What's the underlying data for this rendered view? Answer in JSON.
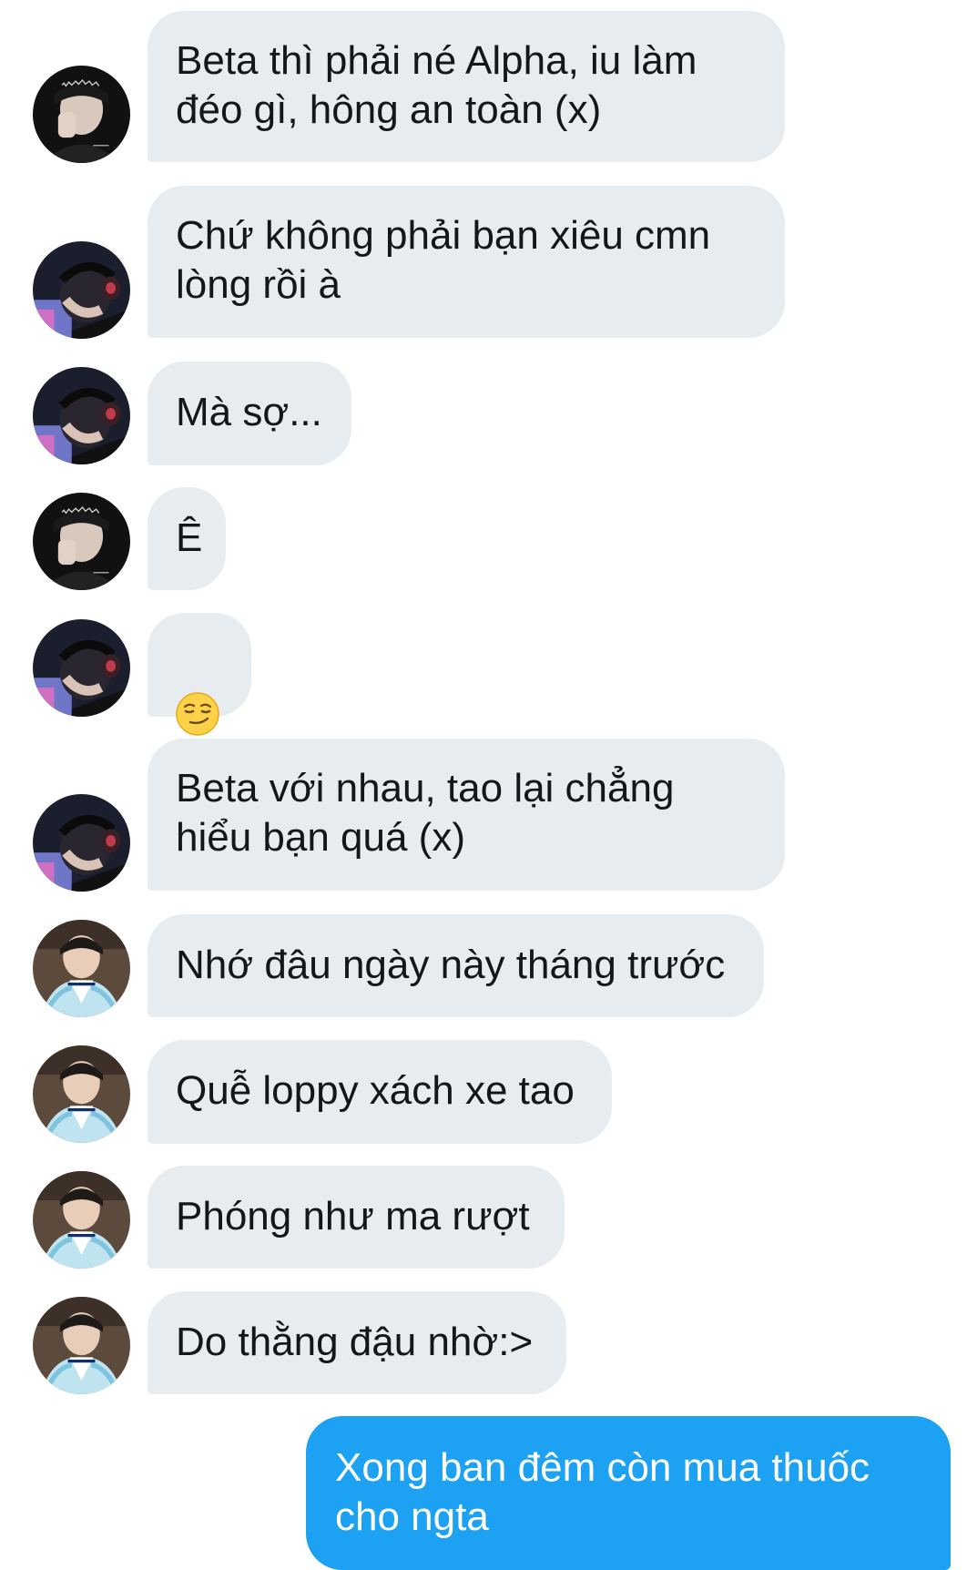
{
  "messages": [
    {
      "text": "Beta thì phải né Alpha, iu làm\nđéo gì, hông an toàn (x)",
      "avatar": "avatar-dark-hand"
    },
    {
      "text": "Chứ không phải bạn xiêu cmn\nlòng rồi à",
      "avatar": "avatar-headset"
    },
    {
      "text": "Mà sợ...",
      "avatar": "avatar-headset"
    },
    {
      "text": "Ê",
      "avatar": "avatar-dark-hand"
    },
    {
      "emoji": "smirking-face-icon",
      "avatar": "avatar-headset"
    },
    {
      "text": "Beta với nhau, tao lại chẳng\nhiểu bạn quá (x)",
      "avatar": "avatar-headset"
    },
    {
      "text": "Nhớ đâu ngày này tháng trước",
      "avatar": "avatar-hanbok"
    },
    {
      "text": "Quễ loppy xách xe tao",
      "avatar": "avatar-hanbok"
    },
    {
      "text": "Phóng như ma rượt",
      "avatar": "avatar-hanbok"
    },
    {
      "text": "Do thằng đậu nhờ:>",
      "avatar": "avatar-hanbok"
    }
  ],
  "sent_message": {
    "text": "Xong ban đêm còn mua thuốc\ncho ngta"
  },
  "colors": {
    "received_bubble": "#e6ecf0",
    "sent_bubble": "#1da1f2",
    "text": "#14171a",
    "background": "#ffffff"
  }
}
